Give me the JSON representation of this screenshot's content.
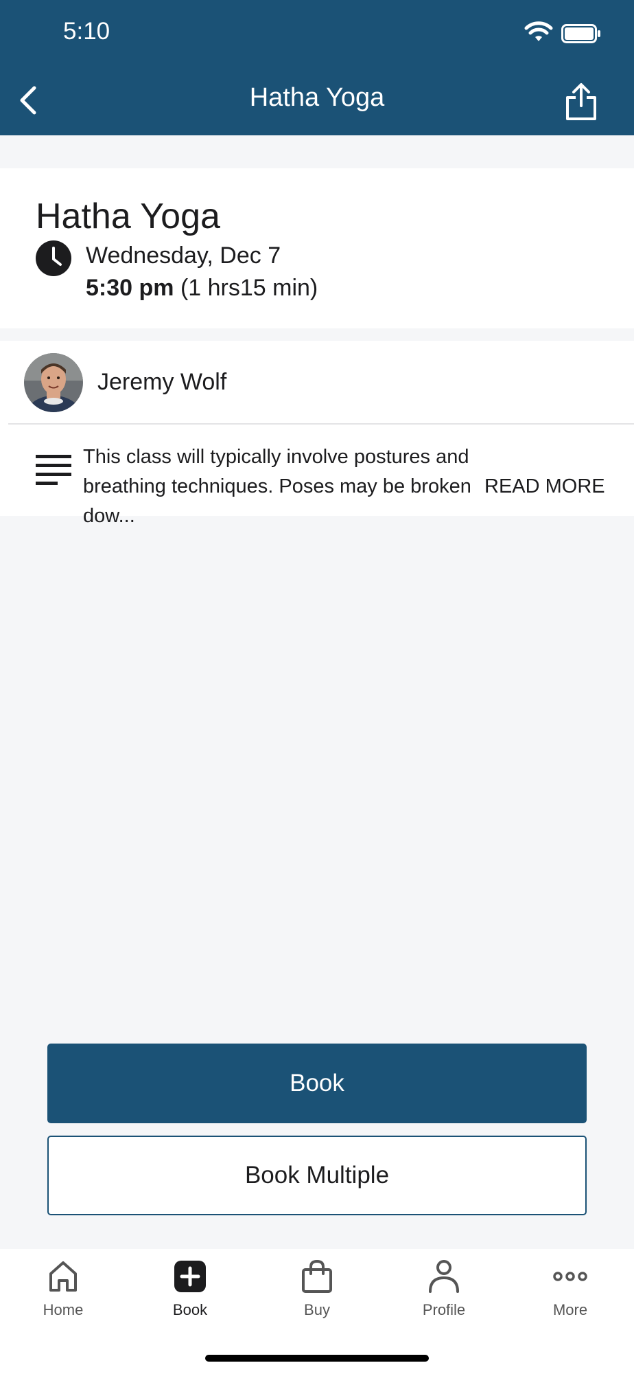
{
  "status_bar": {
    "time": "5:10"
  },
  "header": {
    "title": "Hatha Yoga"
  },
  "class_info": {
    "title": "Hatha Yoga",
    "date": "Wednesday, Dec 7",
    "time": "5:30 pm",
    "duration": "(1 hrs15 min)"
  },
  "instructor": {
    "name": "Jeremy Wolf"
  },
  "description": {
    "text": "This class will typically involve postures and breathing techniques.  Poses may be broken dow...",
    "read_more": "READ MORE"
  },
  "actions": {
    "book": "Book",
    "book_multiple": "Book Multiple"
  },
  "tabs": [
    {
      "label": "Home",
      "icon": "home-icon"
    },
    {
      "label": "Book",
      "icon": "plus-icon"
    },
    {
      "label": "Buy",
      "icon": "bag-icon"
    },
    {
      "label": "Profile",
      "icon": "person-icon"
    },
    {
      "label": "More",
      "icon": "more-icon"
    }
  ],
  "colors": {
    "brand": "#1b5276",
    "background": "#f5f6f8"
  }
}
